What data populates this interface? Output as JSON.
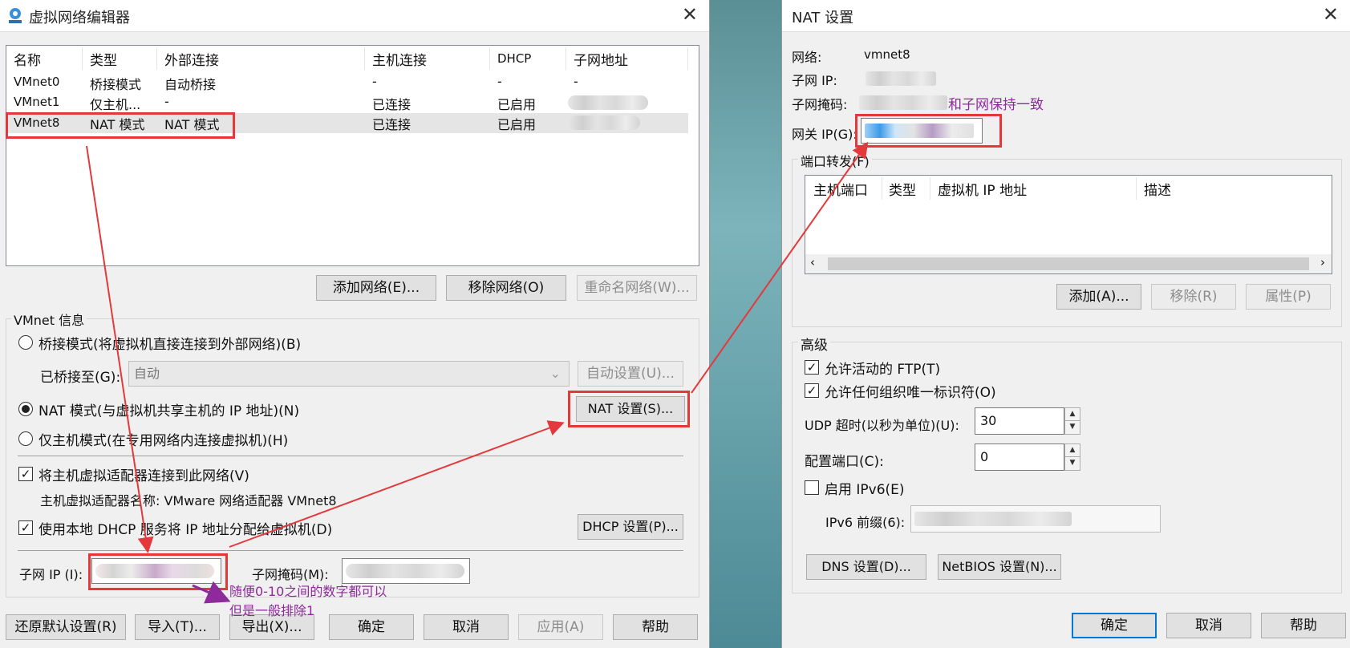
{
  "editor": {
    "title": "虚拟网络编辑器",
    "columns": [
      "名称",
      "类型",
      "外部连接",
      "主机连接",
      "DHCP",
      "子网地址"
    ],
    "rows": [
      {
        "name": "VMnet0",
        "type": "桥接模式",
        "external": "自动桥接",
        "host": "-",
        "dhcp": "-",
        "subnet": "-"
      },
      {
        "name": "VMnet1",
        "type": "仅主机...",
        "external": "-",
        "host": "已连接",
        "dhcp": "已启用",
        "subnet": ""
      },
      {
        "name": "VMnet8",
        "type": "NAT 模式",
        "external": "NAT 模式",
        "host": "已连接",
        "dhcp": "已启用",
        "subnet": ""
      }
    ],
    "add_network": "添加网络(E)...",
    "remove_network": "移除网络(O)",
    "rename_network": "重命名网络(W)...",
    "vmnet_info": "VMnet 信息",
    "bridge_mode": "桥接模式(将虚拟机直接连接到外部网络)(B)",
    "bridged_to_label": "已桥接至(G):",
    "bridged_to_value": "自动",
    "auto_settings": "自动设置(U)...",
    "nat_mode": "NAT 模式(与虚拟机共享主机的 IP 地址)(N)",
    "nat_settings": "NAT 设置(S)...",
    "host_only_mode": "仅主机模式(在专用网络内连接虚拟机)(H)",
    "connect_adapter": "将主机虚拟适配器连接到此网络(V)",
    "adapter_name": "主机虚拟适配器名称: VMware 网络适配器 VMnet8",
    "use_dhcp": "使用本地 DHCP 服务将 IP 地址分配给虚拟机(D)",
    "dhcp_settings": "DHCP 设置(P)...",
    "subnet_ip_label": "子网 IP (I):",
    "subnet_mask_label": "子网掩码(M):",
    "restore_defaults": "还原默认设置(R)",
    "import": "导入(T)...",
    "export": "导出(X)...",
    "ok": "确定",
    "cancel": "取消",
    "apply": "应用(A)",
    "help": "帮助"
  },
  "nat": {
    "title": "NAT 设置",
    "network_label": "网络:",
    "network_value": "vmnet8",
    "subnet_ip_label": "子网 IP:",
    "subnet_mask_label": "子网掩码:",
    "gateway_label": "网关 IP(G):",
    "port_forwarding": "端口转发(F)",
    "pf_columns": [
      "主机端口",
      "类型",
      "虚拟机 IP 地址",
      "描述"
    ],
    "add": "添加(A)...",
    "remove": "移除(R)",
    "properties": "属性(P)",
    "advanced": "高级",
    "allow_ftp": "允许活动的 FTP(T)",
    "allow_uuid": "允许任何组织唯一标识符(O)",
    "udp_timeout_label": "UDP 超时(以秒为单位)(U):",
    "udp_timeout_value": "30",
    "config_port_label": "配置端口(C):",
    "config_port_value": "0",
    "enable_ipv6": "启用 IPv6(E)",
    "ipv6_prefix_label": "IPv6 前缀(6):",
    "dns_settings": "DNS 设置(D)...",
    "netbios_settings": "NetBIOS 设置(N)...",
    "ok": "确定",
    "cancel": "取消",
    "help": "帮助"
  },
  "annotations": {
    "keep_consistent": "和子网保持一致",
    "tip_line1": "随便0-10之间的数字都可以",
    "tip_line2": "但是一般排除1"
  },
  "colors": {
    "highlight": "#e4393c",
    "annotation": "#8e2a9c",
    "focus": "#0078d7"
  }
}
